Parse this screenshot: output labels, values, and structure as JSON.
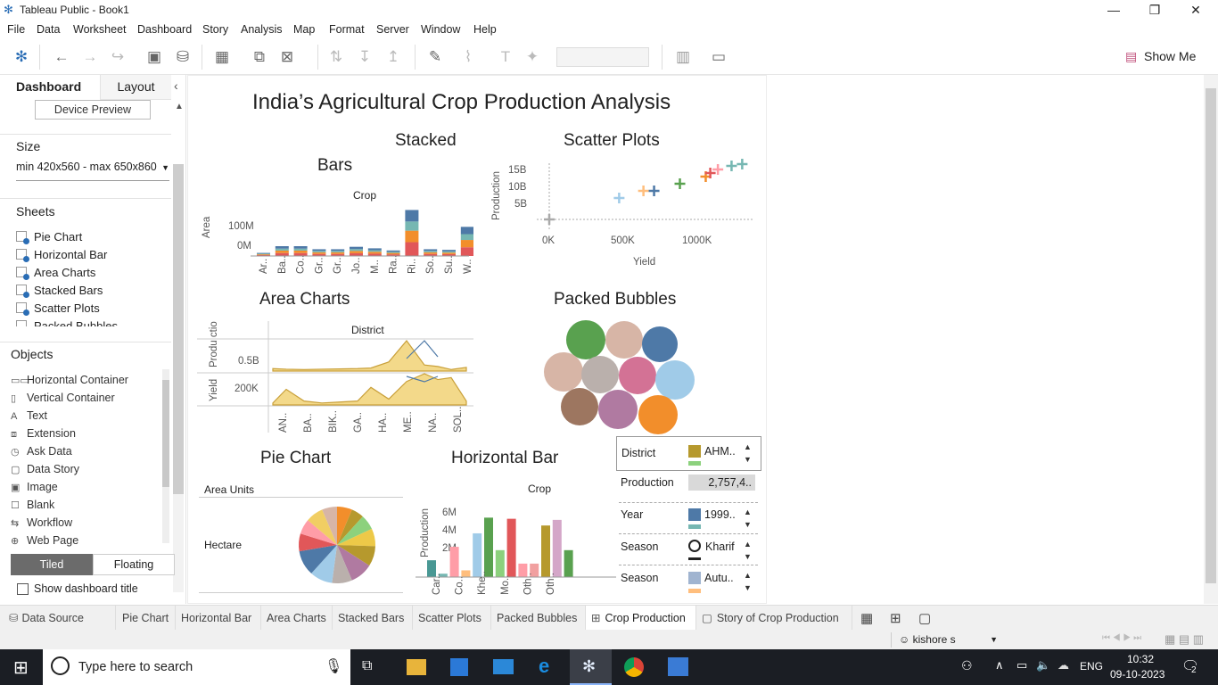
{
  "app": {
    "title": "Tableau Public - Book1"
  },
  "menu": [
    "File",
    "Data",
    "Worksheet",
    "Dashboard",
    "Story",
    "Analysis",
    "Map",
    "Format",
    "Server",
    "Window",
    "Help"
  ],
  "toolbar": {
    "show_me": "Show Me"
  },
  "left": {
    "tab_dashboard": "Dashboard",
    "tab_layout": "Layout",
    "device_preview": "Device Preview",
    "size_label": "Size",
    "size_value": "min 420x560 - max 650x860",
    "sheets_label": "Sheets",
    "sheets": [
      "Pie Chart",
      "Horizontal Bar",
      "Area Charts",
      "Stacked Bars",
      "Scatter Plots",
      "Packed Bubbles"
    ],
    "objects_label": "Objects",
    "objects": [
      "Horizontal Container",
      "Vertical Container",
      "Text",
      "Extension",
      "Ask Data",
      "Data Story",
      "Image",
      "Blank",
      "Workflow",
      "Web Page"
    ],
    "tiled": "Tiled",
    "floating": "Floating",
    "show_title": "Show dashboard title"
  },
  "dashboard": {
    "title": "India’s Agricultural Crop Production Analysis",
    "stacked_title_1": "Stacked",
    "stacked_title_2": "Bars",
    "stacked_header": "Crop",
    "stacked_ylabel": "Area",
    "stacked_yticks": [
      "100M",
      "0M"
    ],
    "scatter_title": "Scatter Plots",
    "scatter_ylabel": "Production",
    "scatter_xlabel": "Yield",
    "scatter_yticks": [
      "15B",
      "10B",
      "5B"
    ],
    "scatter_xticks": [
      "0K",
      "500K",
      "1000K"
    ],
    "area_title": "Area Charts",
    "area_header": "District",
    "area_ylabel1": "Produ ction",
    "area_ylabel2": "Yield",
    "area_ytick1": "0.5B",
    "area_ytick2": "200K",
    "packed_title": "Packed Bubbles",
    "pie_title": "Pie  Chart",
    "pie_header": "Area Units",
    "pie_row": "Hectare",
    "hbar_title": "Horizontal Bar",
    "hbar_header": "Crop",
    "hbar_ylabel": "Production",
    "hbar_yticks": [
      "6M",
      "4M",
      "2M"
    ],
    "filters": {
      "district_label": "District",
      "district_value": "AHM..",
      "production_label": "Production",
      "production_value": "2,757,4..",
      "year_label": "Year",
      "year_value": "1999..",
      "season_label": "Season",
      "season_value": "Kharif",
      "season2_label": "Season",
      "season2_value": "Autu.."
    }
  },
  "chart_data": [
    {
      "type": "bar",
      "title": "Stacked Bars",
      "xlabel": "Crop",
      "ylabel": "Area",
      "categories": [
        "Ar..",
        "Ba..",
        "Co..",
        "Gr..",
        "Gr..",
        "Jo..",
        "M..",
        "Ra..",
        "Ri..",
        "So..",
        "Su..",
        "W.."
      ],
      "values": [
        10,
        32,
        32,
        22,
        22,
        30,
        25,
        18,
        150,
        22,
        20,
        95
      ],
      "ylim": [
        0,
        160
      ]
    },
    {
      "type": "scatter",
      "title": "Scatter Plots",
      "xlabel": "Yield",
      "ylabel": "Production",
      "x": [
        0,
        460,
        620,
        690,
        860,
        1030,
        1060,
        1110,
        1200,
        1270
      ],
      "y": [
        0,
        6,
        8,
        8,
        10,
        12,
        13,
        14,
        15,
        15.5
      ],
      "xlim": [
        -100,
        1350
      ],
      "ylim": [
        -1,
        17
      ]
    },
    {
      "type": "area",
      "title": "Area Charts",
      "xlabel": "District",
      "categories": [
        "AN..",
        "BA..",
        "BIK..",
        "GA..",
        "HA..",
        "ME..",
        "NA..",
        "SOL.."
      ],
      "series": [
        {
          "values": [
            0.08,
            0.06,
            0.05,
            0.06,
            0.07,
            0.08,
            0.1,
            0.3,
            1.0,
            0.2,
            0.15,
            0.05,
            0.12
          ]
        },
        {
          "values": [
            10,
            80,
            20,
            10,
            15,
            20,
            90,
            30,
            120,
            160,
            130,
            140,
            20
          ]
        }
      ]
    },
    {
      "type": "pie",
      "title": "Pie  Chart",
      "values": [
        6,
        5,
        6,
        7,
        8,
        9,
        8,
        9,
        10,
        7,
        6,
        7,
        6
      ]
    },
    {
      "type": "bar",
      "title": "Horizontal Bar",
      "xlabel": "Crop",
      "ylabel": "Production",
      "categories": [
        "Car..",
        "Co..",
        "Khe..",
        "Mo..",
        "Oth..",
        "Oth.."
      ],
      "values": [
        1.5,
        0.3,
        2.7,
        0.6,
        3.9,
        5.3,
        2.4,
        5.2,
        1.2,
        1.2,
        4.6,
        5.1,
        2.4
      ],
      "ylim": [
        0,
        7
      ]
    }
  ],
  "tabs": [
    "Data Source",
    "Pie Chart",
    "Horizontal Bar",
    "Area Charts",
    "Stacked Bars",
    "Scatter Plots",
    "Packed Bubbles",
    "Crop Production",
    "Story of Crop Production"
  ],
  "status": {
    "user": "kishore s"
  },
  "taskbar": {
    "search": "Type here to search",
    "lang": "ENG",
    "time": "10:32",
    "date": "09-10-2023",
    "notif": "2"
  }
}
